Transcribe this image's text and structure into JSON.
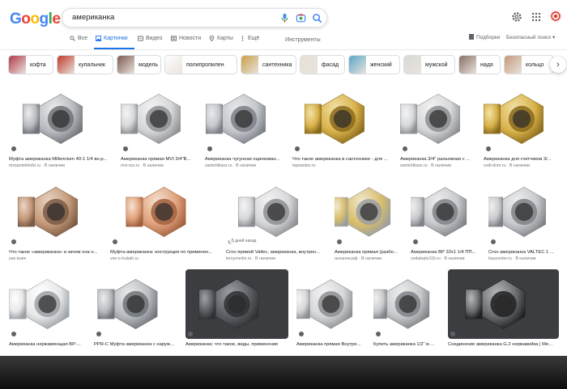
{
  "search": {
    "query": "американка",
    "logo": [
      "G",
      "o",
      "o",
      "g",
      "l",
      "e"
    ],
    "logo_colors": [
      "#4285f4",
      "#ea4335",
      "#fbbc05",
      "#4285f4",
      "#34a853",
      "#ea4335"
    ]
  },
  "tabs": [
    {
      "label": "Все",
      "icon": "search-icon",
      "active": false
    },
    {
      "label": "Картинки",
      "icon": "image-icon",
      "active": true
    },
    {
      "label": "Видео",
      "icon": "video-icon",
      "active": false
    },
    {
      "label": "Новости",
      "icon": "news-icon",
      "active": false
    },
    {
      "label": "Карты",
      "icon": "map-pin-icon",
      "active": false
    },
    {
      "label": "Ещё",
      "icon": "more-icon",
      "active": false
    }
  ],
  "tools_label": "Инструменты",
  "right_links": {
    "collections": "Подборки",
    "safe_search": "Безопасный поиск"
  },
  "chips": [
    {
      "label": "кофта",
      "color": "#b23a48"
    },
    {
      "label": "купальник",
      "color": "#c0392b"
    },
    {
      "label": "модель",
      "color": "#7d5a50"
    },
    {
      "label": "полипропилен",
      "color": "#ffffff"
    },
    {
      "label": "сантехника",
      "color": "#c9a04a"
    },
    {
      "label": "фасад",
      "color": "#e6e0d8"
    },
    {
      "label": "женский",
      "color": "#5aa6c9"
    },
    {
      "label": "мужской",
      "color": "#d9d9d9"
    },
    {
      "label": "надя",
      "color": "#8a6e66"
    },
    {
      "label": "кольцо",
      "color": "#c49a7a"
    }
  ],
  "results": [
    {
      "caption": "Муфта американка Millennium 40-1 1/4 вн.р...",
      "source": "mosantekhniki.ru",
      "availability": "В наличии",
      "style": "steel-white"
    },
    {
      "caption": "Американка прямая MVI 3/4\"В...",
      "source": "mvi-rus.ru",
      "availability": "В наличии",
      "style": "nickel"
    },
    {
      "caption": "Американка чугунная оцинкован...",
      "source": "santehklass.ru",
      "availability": "В наличии",
      "style": "galv"
    },
    {
      "caption": "Что такое американка в сантехнике - для ...",
      "source": "topsantex.ru",
      "availability": "",
      "style": "brass"
    },
    {
      "caption": "Американка 3/4\" разъемная с ...",
      "source": "santehklass.ru",
      "availability": "В наличии",
      "style": "nickel"
    },
    {
      "caption": "Американка для счетчиков 3/...",
      "source": "vodi-dom.ru",
      "availability": "В наличии",
      "style": "brass"
    },
    {
      "caption": "Что такое «американка» и зачем она н...",
      "source": "san.team",
      "availability": "",
      "style": "bronze"
    },
    {
      "caption": "Муфта-американка: инструкция по применен...",
      "source": "vse-o-trubah.ru",
      "availability": "",
      "style": "copper"
    },
    {
      "caption": "Сгон прямой Valtec, американка, внутрен...",
      "source": "leroymerlin.ru",
      "availability": "В наличии",
      "style": "nickel",
      "date": "5 дней назад"
    },
    {
      "caption": "Американка прямая (разбо...",
      "source": "ансанни.рф",
      "availability": "В наличии",
      "style": "brass-nickel"
    },
    {
      "caption": "Американка ВР 32х1 1/4 ПП...",
      "source": "vodateplo116.ru",
      "availability": "В наличии",
      "style": "steel"
    },
    {
      "caption": "Сгон американка VALTEC 1 ...",
      "source": "baucenter.ru",
      "availability": "В наличии",
      "style": "steel"
    },
    {
      "caption": "Американка нержавеющая ВР-...",
      "source": "",
      "availability": "",
      "style": "drawing"
    },
    {
      "caption": "PPR-C Муфта американка с наруж...",
      "source": "",
      "availability": "",
      "style": "steel-white"
    },
    {
      "caption": "Американка: что такое, виды, применение",
      "source": "",
      "availability": "",
      "style": "dark"
    },
    {
      "caption": "Американка прямая Внутре...",
      "source": "",
      "availability": "",
      "style": "nickel"
    },
    {
      "caption": "Купить американка 1/2\" в-...",
      "source": "",
      "availability": "",
      "style": "steel"
    },
    {
      "caption": "Соединение американка G.2 нержавейка | Ме...",
      "source": "",
      "availability": "",
      "style": "dark-photo"
    }
  ]
}
